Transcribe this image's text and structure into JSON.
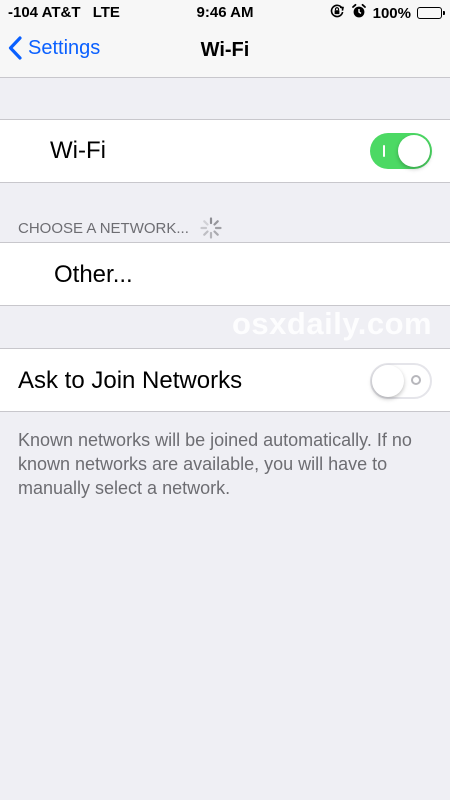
{
  "status_bar": {
    "signal": "-104",
    "carrier": "AT&T",
    "network": "LTE",
    "time": "9:46 AM",
    "battery": "100%"
  },
  "nav": {
    "back_label": "Settings",
    "title": "Wi-Fi"
  },
  "wifi_row": {
    "label": "Wi-Fi",
    "toggle_state": "on"
  },
  "networks_section": {
    "header": "CHOOSE A NETWORK...",
    "other_label": "Other..."
  },
  "ask_row": {
    "label": "Ask to Join Networks",
    "toggle_state": "off"
  },
  "footer": {
    "text": "Known networks will be joined automatically. If no known networks are available, you will have to manually select a network."
  },
  "watermark": "osxdaily.com",
  "colors": {
    "accent": "#0a60ff",
    "toggle_on": "#4cd964",
    "background": "#efeff4",
    "secondary_text": "#6d6d72"
  },
  "icons": {
    "back": "chevron-left-icon",
    "rotation_lock": "rotation-lock-icon",
    "alarm": "alarm-clock-icon",
    "battery": "battery-icon",
    "loading": "loading-spinner-icon"
  }
}
